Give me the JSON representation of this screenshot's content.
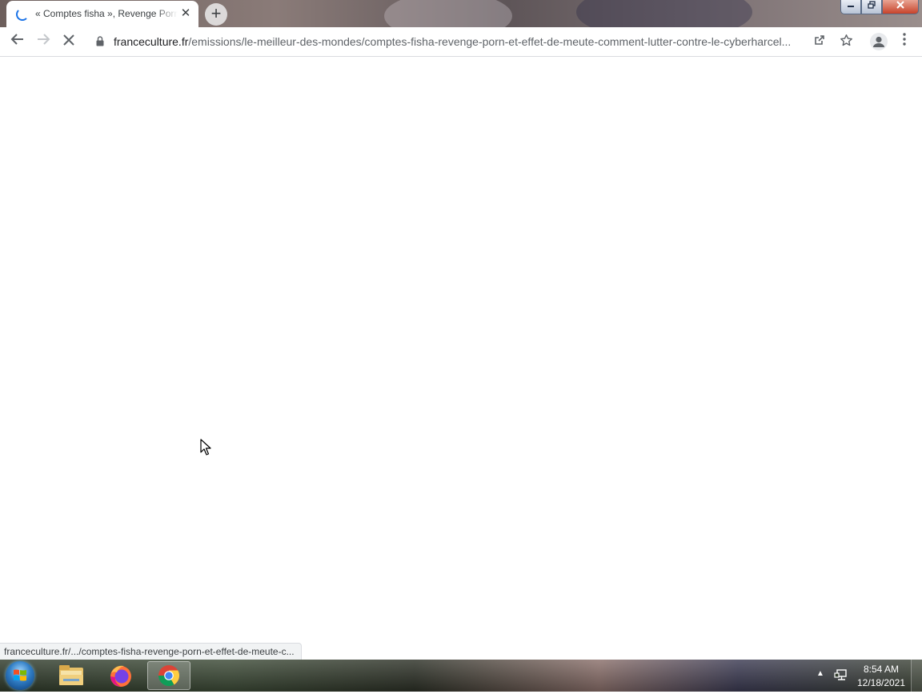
{
  "browser": {
    "tab": {
      "title": "« Comptes fisha », Revenge Porn et effet de meute",
      "loading": true
    },
    "new_tab_label": "+",
    "url": {
      "host": "franceculture.fr",
      "path": "/emissions/le-meilleur-des-mondes/comptes-fisha-revenge-porn-et-effet-de-meute-comment-lutter-contre-le-cyberharcel..."
    },
    "status_text": "franceculture.fr/.../comptes-fisha-revenge-porn-et-effet-de-meute-c...",
    "icons": {
      "back": "arrow-left-icon",
      "forward": "arrow-right-icon",
      "stop": "close-icon",
      "lock": "lock-icon",
      "share": "share-icon",
      "bookmark": "star-icon",
      "profile": "person-icon",
      "menu": "kebab-menu-icon"
    },
    "accent_color": "#1a73e8"
  },
  "window_controls": {
    "minimize": "minimize-icon",
    "maximize": "restore-icon",
    "close": "close-icon"
  },
  "taskbar": {
    "apps": [
      {
        "name": "windows-explorer",
        "icon": "folder-icon",
        "active": false
      },
      {
        "name": "firefox",
        "icon": "firefox-icon",
        "active": false
      },
      {
        "name": "chrome",
        "icon": "chrome-icon",
        "active": true
      }
    ],
    "clock": {
      "time": "8:54 AM",
      "date": "12/18/2021"
    }
  }
}
